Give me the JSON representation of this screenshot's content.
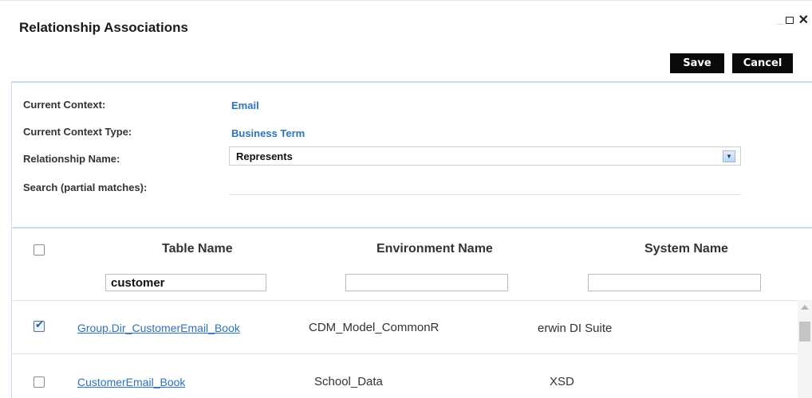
{
  "dialog": {
    "title": "Relationship Associations",
    "maximize_icon": "maximize-icon",
    "close_icon": "close-icon",
    "close_glyph": "✕"
  },
  "toolbar": {
    "save_label": "Save",
    "cancel_label": "Cancel"
  },
  "form": {
    "current_context_label": "Current Context:",
    "current_context_value": "Email",
    "context_type_label": "Current Context Type:",
    "context_type_value": "Business Term",
    "relationship_name_label": "Relationship Name:",
    "relationship_name_value": "Represents",
    "search_label": "Search (partial matches):",
    "search_value": ""
  },
  "grid": {
    "columns": [
      "Table Name",
      "Environment Name",
      "System Name"
    ],
    "filters": {
      "table_name": "customer",
      "environment_name": "",
      "system_name": ""
    },
    "rows": [
      {
        "checked": true,
        "table_name": "Group.Dir_CustomerEmail_Book",
        "environment_name": "CDM_Model_CommonR",
        "system_name": "erwin DI Suite"
      },
      {
        "checked": false,
        "table_name": "CustomerEmail_Book",
        "environment_name": "School_Data",
        "system_name": "XSD"
      }
    ]
  },
  "colors": {
    "accent_link": "#2a73c5",
    "button_bg": "#0a0a0a",
    "divider": "#c9dcef"
  }
}
